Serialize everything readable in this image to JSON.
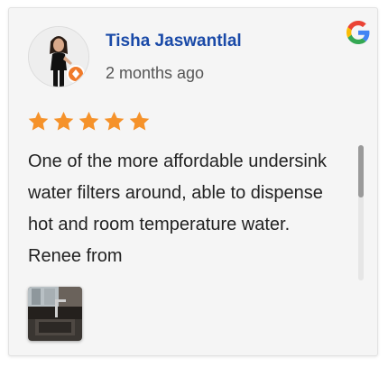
{
  "review": {
    "author_name": "Tisha Jaswantlal",
    "time_ago": "2 months ago",
    "rating": 5,
    "max_rating": 5,
    "text": "One of the more affordable undersink water filters around, able to dispense hot and room temperature water. Renee from"
  },
  "icons": {
    "platform": "google-icon",
    "star": "star-icon",
    "badge": "local-guide-badge-icon"
  },
  "colors": {
    "author_name": "#1a4aa8",
    "star": "#f5922a",
    "text": "#222222",
    "time": "#555555"
  }
}
